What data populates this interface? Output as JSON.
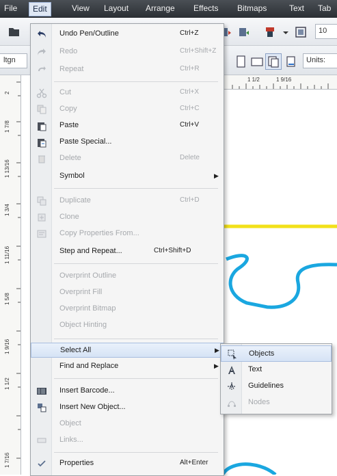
{
  "menubar": {
    "items": [
      "File",
      "Edit",
      "View",
      "Layout",
      "Arrange",
      "Effects",
      "Bitmaps",
      "Text",
      "Tab"
    ]
  },
  "toolbar": {
    "left_label": "ltgn",
    "zoom_value": "10",
    "units_label": "Units:"
  },
  "rulers": {
    "vertical_labels": [
      "2",
      "1 7/8",
      "1 13/16",
      "1 3/4",
      "1 11/16",
      "1 5/8",
      "1 9/16",
      "1 1/2",
      "1 7/16"
    ],
    "horizontal_labels": [
      "1 1/2",
      "1 9/16"
    ]
  },
  "edit_menu": {
    "items": [
      {
        "label": "Undo Pen/Outline",
        "shortcut": "Ctrl+Z",
        "enabled": true,
        "icon": "undo-icon"
      },
      {
        "label": "Redo",
        "shortcut": "Ctrl+Shift+Z",
        "enabled": false,
        "icon": "redo-icon"
      },
      {
        "label": "Repeat",
        "shortcut": "Ctrl+R",
        "enabled": false,
        "icon": "repeat-icon"
      },
      {
        "label": "Cut",
        "shortcut": "Ctrl+X",
        "enabled": false,
        "icon": "cut-icon"
      },
      {
        "label": "Copy",
        "shortcut": "Ctrl+C",
        "enabled": false,
        "icon": "copy-icon"
      },
      {
        "label": "Paste",
        "shortcut": "Ctrl+V",
        "enabled": true,
        "icon": "paste-icon"
      },
      {
        "label": "Paste Special...",
        "shortcut": "",
        "enabled": true,
        "icon": "paste-special-icon"
      },
      {
        "label": "Delete",
        "shortcut": "Delete",
        "enabled": false,
        "icon": "delete-icon"
      },
      {
        "label": "Symbol",
        "shortcut": "",
        "enabled": true,
        "icon": "",
        "submenu": true
      },
      {
        "label": "Duplicate",
        "shortcut": "Ctrl+D",
        "enabled": false,
        "icon": "duplicate-icon"
      },
      {
        "label": "Clone",
        "shortcut": "",
        "enabled": false,
        "icon": "clone-icon"
      },
      {
        "label": "Copy Properties From...",
        "shortcut": "",
        "enabled": false,
        "icon": "copy-properties-icon"
      },
      {
        "label": "Step and Repeat...",
        "shortcut": "Ctrl+Shift+D",
        "enabled": true,
        "icon": ""
      },
      {
        "label": "Overprint Outline",
        "shortcut": "",
        "enabled": false,
        "icon": ""
      },
      {
        "label": "Overprint Fill",
        "shortcut": "",
        "enabled": false,
        "icon": ""
      },
      {
        "label": "Overprint Bitmap",
        "shortcut": "",
        "enabled": false,
        "icon": ""
      },
      {
        "label": "Object Hinting",
        "shortcut": "",
        "enabled": false,
        "icon": ""
      },
      {
        "label": "Select All",
        "shortcut": "",
        "enabled": true,
        "icon": "",
        "submenu": true
      },
      {
        "label": "Find and Replace",
        "shortcut": "",
        "enabled": true,
        "icon": "",
        "submenu": true
      },
      {
        "label": "Insert Barcode...",
        "shortcut": "",
        "enabled": true,
        "icon": "barcode-icon"
      },
      {
        "label": "Insert New Object...",
        "shortcut": "",
        "enabled": true,
        "icon": "insert-object-icon"
      },
      {
        "label": "Object",
        "shortcut": "",
        "enabled": false,
        "icon": ""
      },
      {
        "label": "Links...",
        "shortcut": "",
        "enabled": false,
        "icon": "links-icon"
      },
      {
        "label": "Properties",
        "shortcut": "Alt+Enter",
        "enabled": true,
        "icon": "checkmark-icon"
      }
    ]
  },
  "select_all_submenu": {
    "items": [
      {
        "label": "Objects",
        "enabled": true,
        "icon": "objects-icon"
      },
      {
        "label": "Text",
        "enabled": true,
        "icon": "text-icon"
      },
      {
        "label": "Guidelines",
        "enabled": true,
        "icon": "guidelines-icon"
      },
      {
        "label": "Nodes",
        "enabled": false,
        "icon": "nodes-icon"
      }
    ]
  },
  "colors": {
    "menubar_bg": "#33373c",
    "highlight": "#d6e3f5",
    "yellow_line": "#f2e11a",
    "blue_shape": "#1aa7e0",
    "disabled_text": "#a6a9ad"
  }
}
